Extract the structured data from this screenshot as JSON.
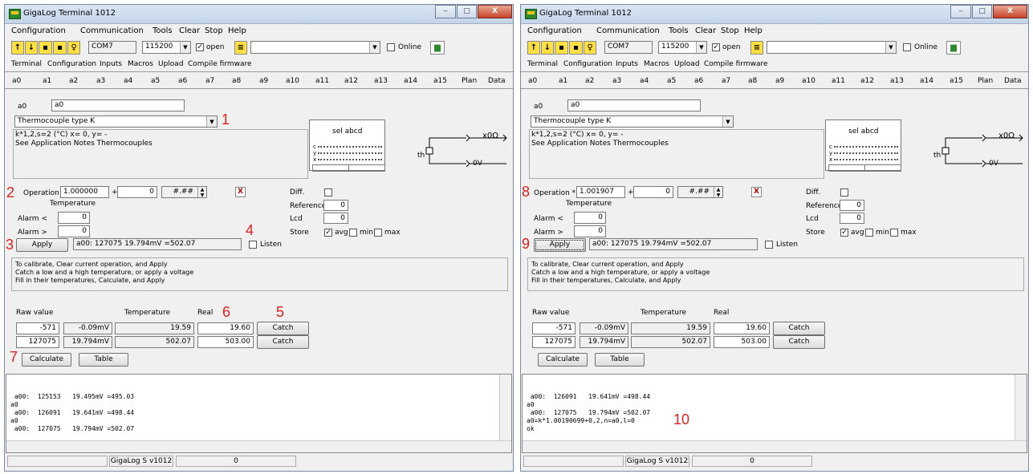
{
  "window_title": "GigaLog Terminal 1012",
  "title_buttons": {
    "minimize": "‒",
    "maximize": "□",
    "close": "X"
  },
  "menu": [
    "Configuration",
    "Communication",
    "Tools",
    "Clear",
    "Stop",
    "Help"
  ],
  "toolbar": {
    "port": "COM7",
    "baud": "115200",
    "open_label": "open",
    "online_label": "Online"
  },
  "main_tabs": [
    "Terminal",
    "Configuration",
    "Inputs",
    "Macros",
    "Upload",
    "Compile firmware"
  ],
  "input_tabs": [
    "a0",
    "a1",
    "a2",
    "a3",
    "a4",
    "a5",
    "a6",
    "a7",
    "a8",
    "a9",
    "a10",
    "a11",
    "a12",
    "a13",
    "a14",
    "a15",
    "Plan",
    "Data"
  ],
  "channel": {
    "label": "a0",
    "name": "a0"
  },
  "sensor_type": "Thermocouple type K",
  "sensor_formula": "k*1,2,s=2 (°C)  x= 0, y= -",
  "sensor_note": "See Application Notes Thermocouples",
  "diagram": {
    "sel": "sel abcd",
    "c": "c",
    "y": "y",
    "x": "x",
    "out1": "x0Ω",
    "out2": "0V",
    "th": "th"
  },
  "labels": {
    "operation": "Operation *",
    "plus": "+",
    "format": "#.##",
    "temperature": "Temperature",
    "alarm_lt": "Alarm  <",
    "alarm_gt": "Alarm  >",
    "diff": "Diff.",
    "reference": "Reference",
    "lcd": "Lcd",
    "store": "Store",
    "avg": "avg",
    "min": "min",
    "max": "max",
    "apply": "Apply",
    "listen": "Listen",
    "raw_value": "Raw value",
    "temperature_col": "Temperature",
    "real": "Real",
    "catch": "Catch",
    "calculate": "Calculate",
    "table": "Table"
  },
  "values": {
    "offset": "0",
    "alarm_low": "0",
    "alarm_high": "0",
    "reference": "0",
    "lcd": "0"
  },
  "help_text": "To calibrate, Clear current operation, and Apply\nCatch a low and a high temperature, or apply a voltage\nFill in their temperatures, Calculate, and Apply",
  "calib_rows": [
    {
      "raw": "-571",
      "mv": "-0.09mV",
      "temp": "19.59",
      "real": "19.60"
    },
    {
      "raw": "127075",
      "mv": "19.794mV",
      "temp": "502.07",
      "real": "503.00"
    }
  ],
  "left": {
    "multiplier": "1.000000",
    "status_reading": "a00:  127075  19.794mV =502.07",
    "console": " a00:  125153   19.495mV =495.03\na0\n a00:  126091   19.641mV =498.44\na0\n a00:  127075   19.794mV =502.07"
  },
  "right": {
    "multiplier": "1.001907",
    "status_reading": "a00:  127075  19.794mV =502.07",
    "console": " a00:  126091   19.641mV =498.44\na0\n a00:  127075   19.794mV =502.07\na0=k*1.00190699+0,2,n=a0,l=0\nok"
  },
  "statusbar": {
    "app": "GigaLog S v1012",
    "count": "0"
  },
  "annotations": {
    "n1": "1",
    "n2": "2",
    "n3": "3",
    "n4": "4",
    "n5": "5",
    "n6": "6",
    "n7": "7",
    "n8": "8",
    "n9": "9",
    "n10": "10"
  },
  "colors": {
    "annotation": "#e02020",
    "toolbar_yellow": "#ffe040"
  }
}
